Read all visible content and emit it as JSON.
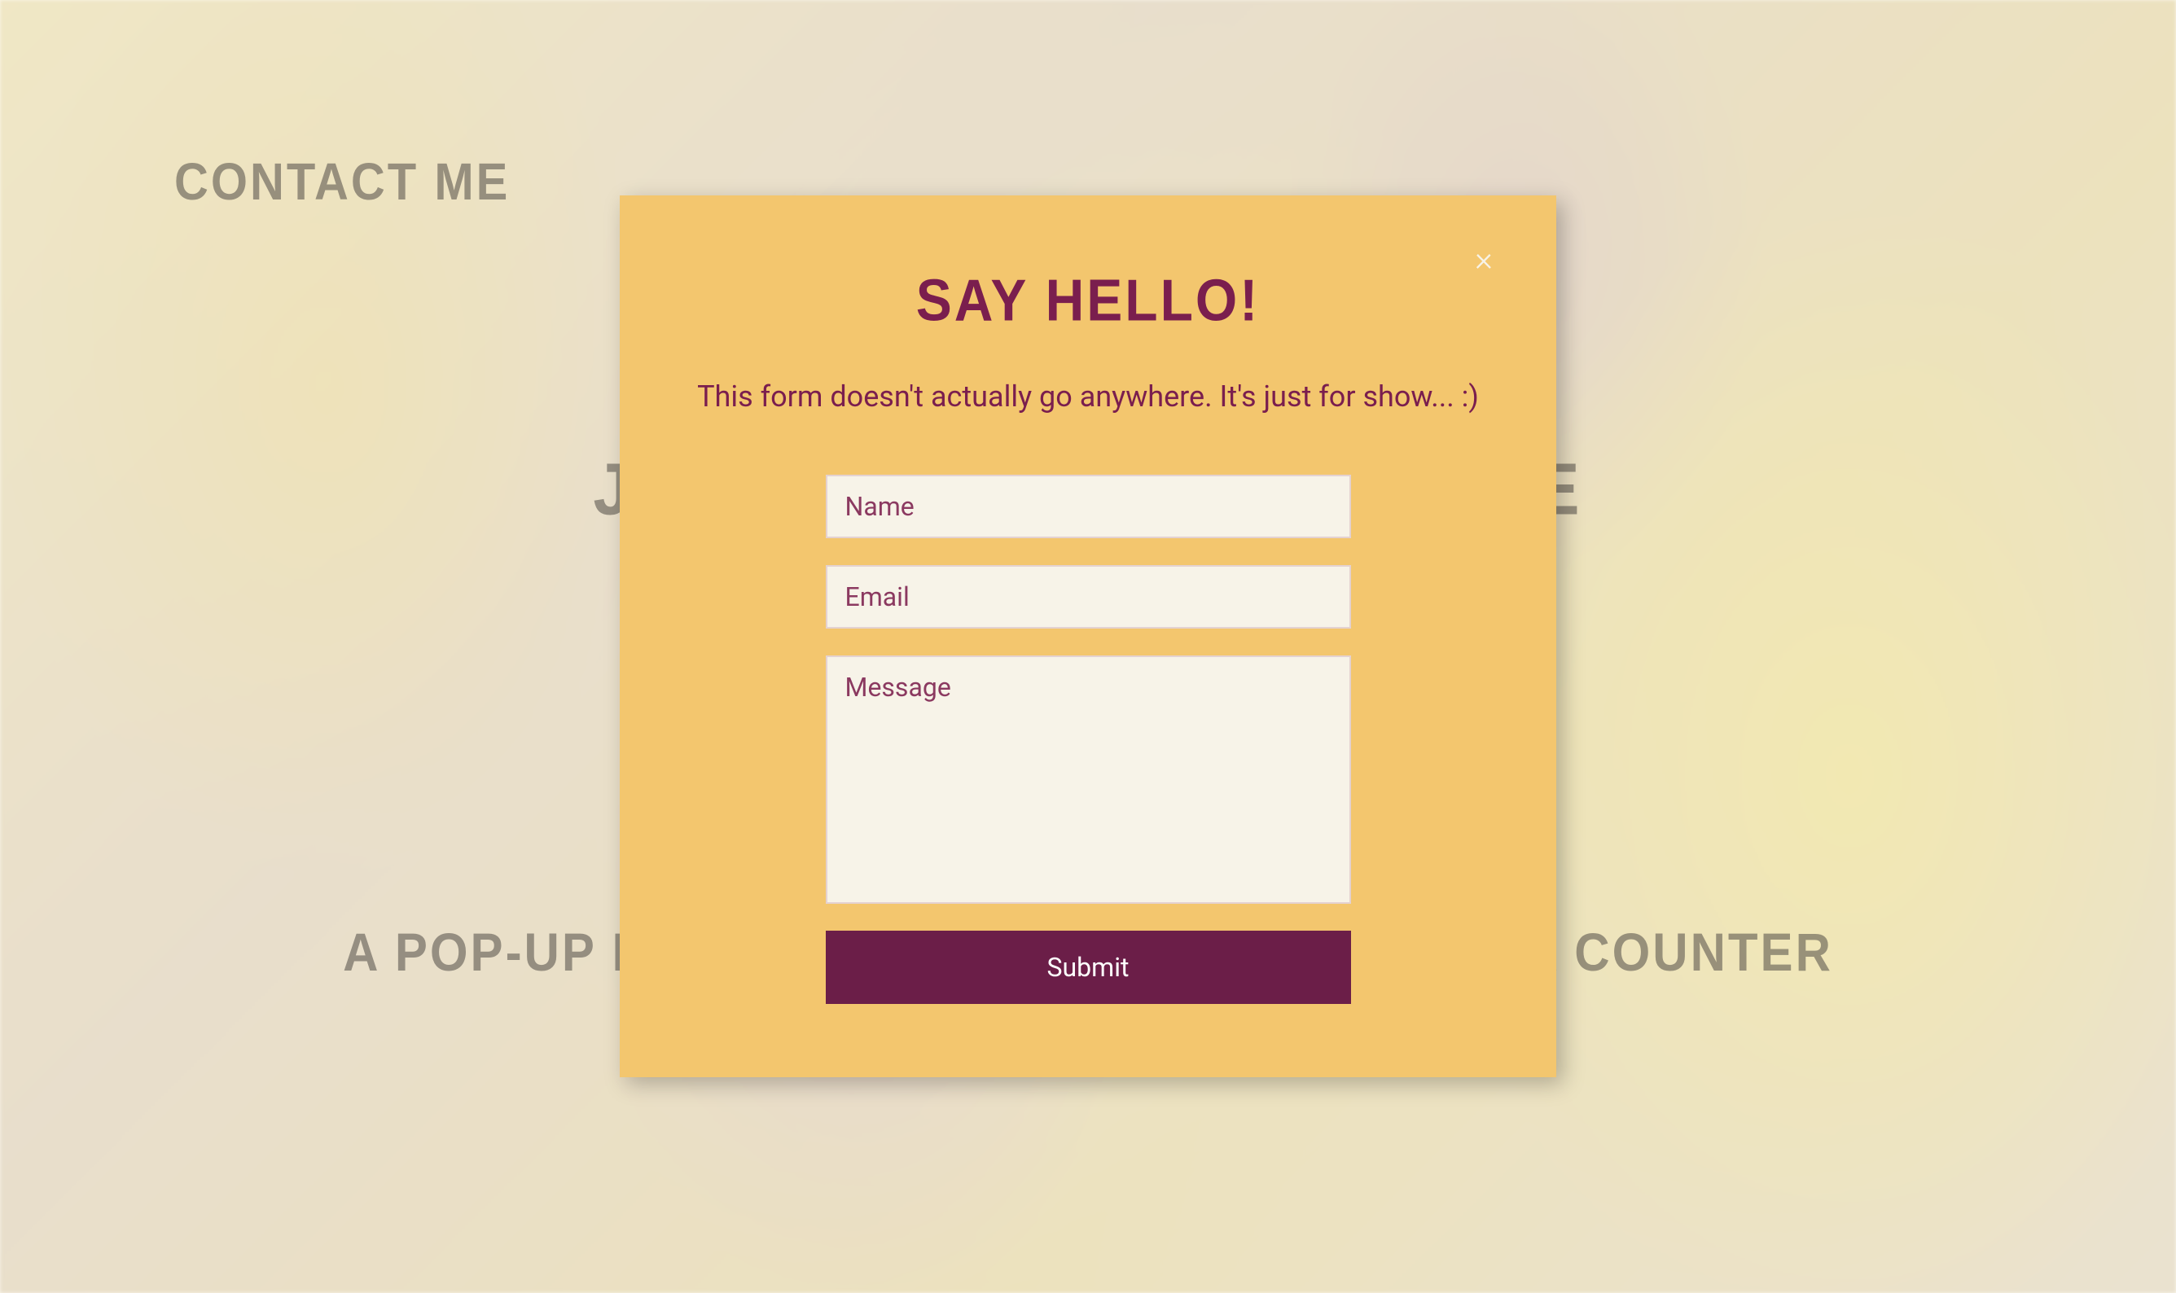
{
  "nav": {
    "contact_link": "Contact Me"
  },
  "background_page": {
    "title_prefix": "Ja",
    "title_suffix": "te",
    "subtitle_prefix": "A pop-up moda",
    "subtitle_suffix": "and a counter"
  },
  "modal": {
    "title": "Say Hello!",
    "description": "This form doesn't actually go anywhere. It's just for show... :)",
    "close_glyph": "×",
    "form": {
      "name_placeholder": "Name",
      "email_placeholder": "Email",
      "message_placeholder": "Message",
      "submit_label": "Submit"
    }
  },
  "colors": {
    "modal_bg": "#f3c66e",
    "accent": "#7a1e4e",
    "button_bg": "#6b1e48",
    "input_bg": "#f7f3e8"
  }
}
